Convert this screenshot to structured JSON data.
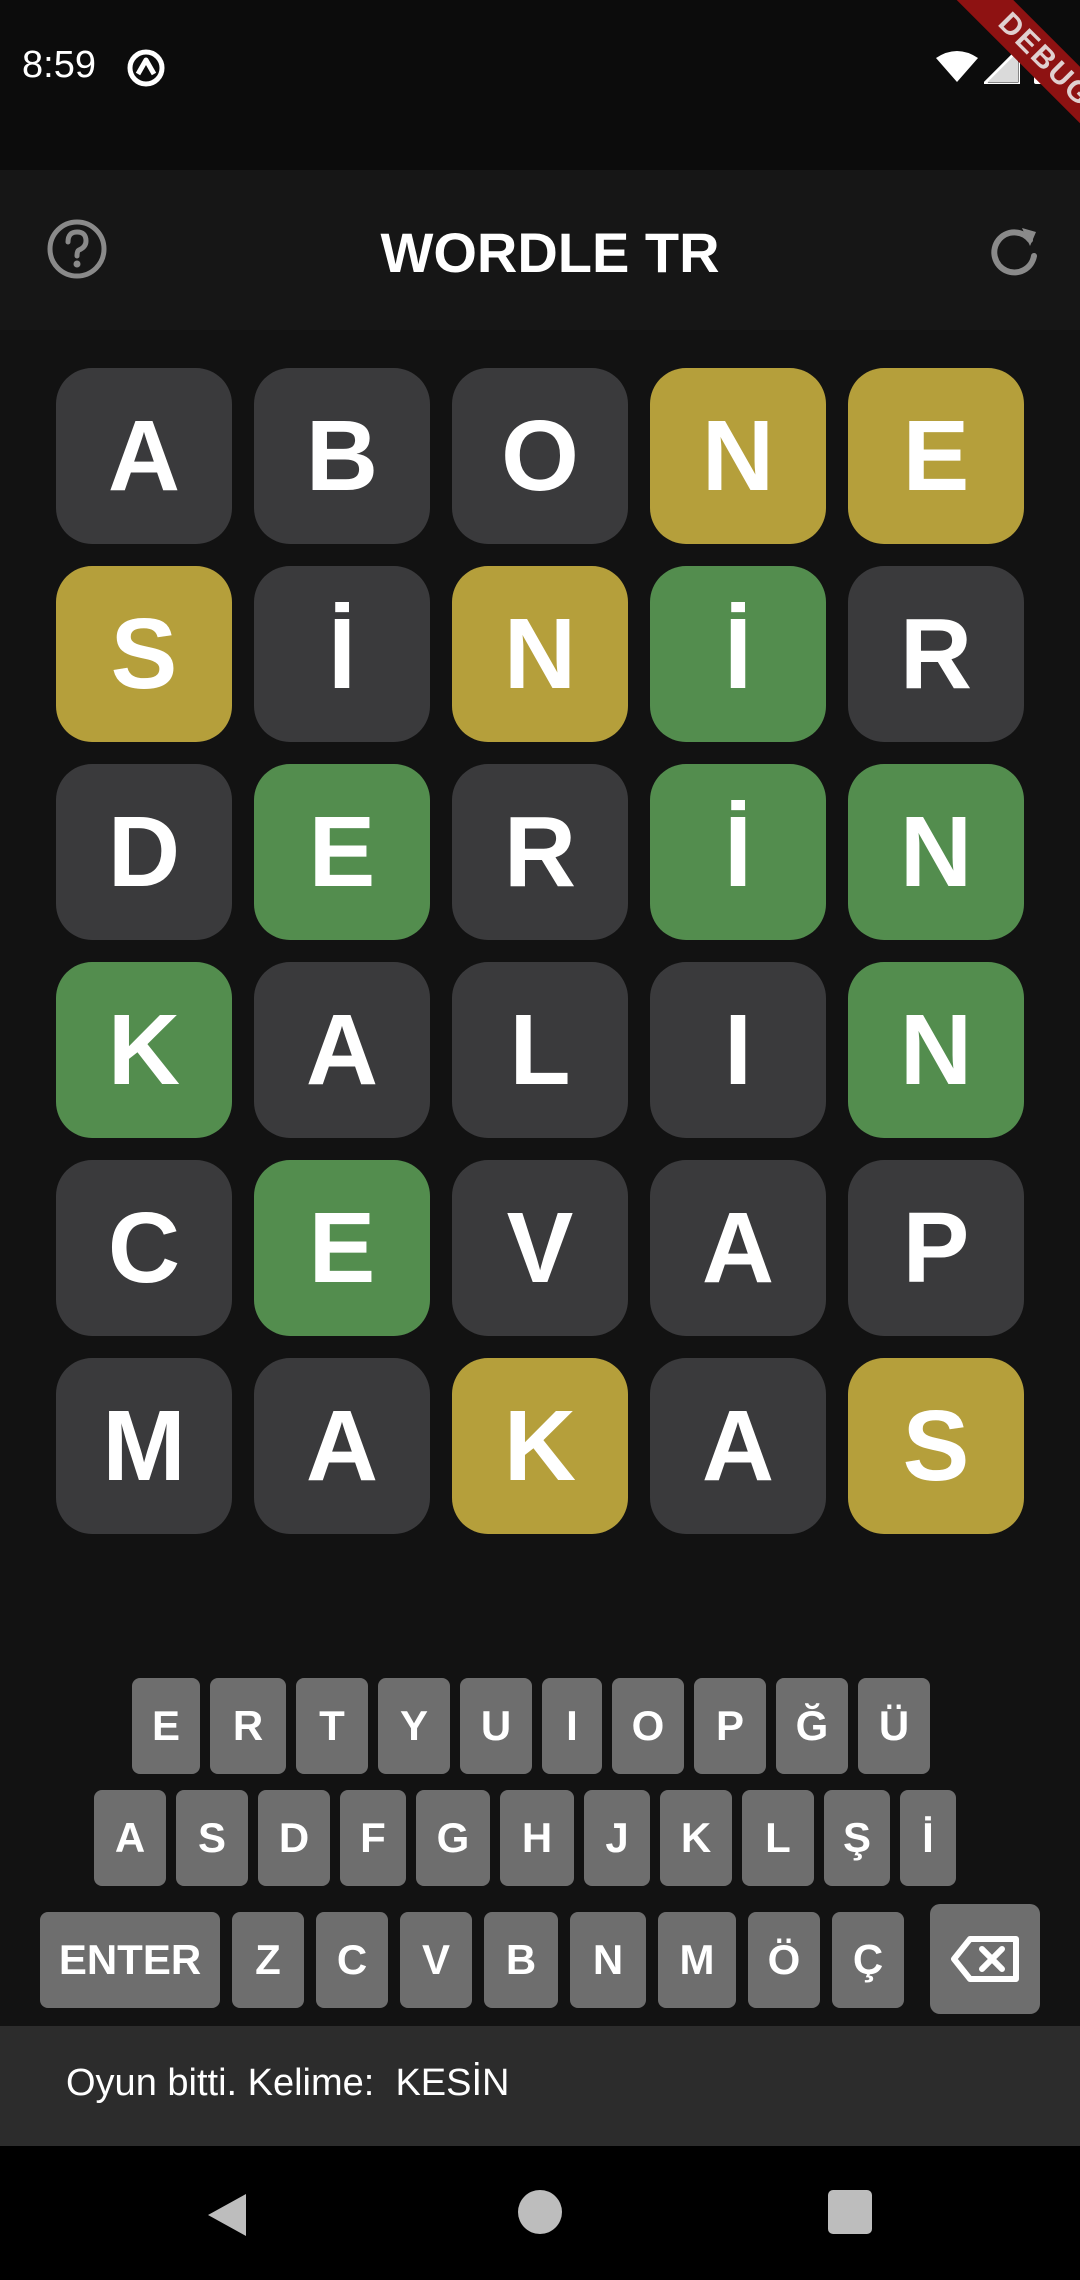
{
  "status_bar": {
    "time": "8:59",
    "debug_label": "DEBUG",
    "icons": [
      "app-notification-icon",
      "wifi-icon",
      "signal-icon",
      "battery-icon"
    ]
  },
  "app_bar": {
    "title": "WORDLE TR",
    "left_icon": "help-icon",
    "right_icon": "refresh-icon"
  },
  "board": {
    "rows": [
      [
        {
          "letter": "A",
          "state": "absent"
        },
        {
          "letter": "B",
          "state": "absent"
        },
        {
          "letter": "O",
          "state": "absent"
        },
        {
          "letter": "N",
          "state": "present"
        },
        {
          "letter": "E",
          "state": "present"
        }
      ],
      [
        {
          "letter": "S",
          "state": "present"
        },
        {
          "letter": "İ",
          "state": "absent"
        },
        {
          "letter": "N",
          "state": "present"
        },
        {
          "letter": "İ",
          "state": "correct"
        },
        {
          "letter": "R",
          "state": "absent"
        }
      ],
      [
        {
          "letter": "D",
          "state": "absent"
        },
        {
          "letter": "E",
          "state": "correct"
        },
        {
          "letter": "R",
          "state": "absent"
        },
        {
          "letter": "İ",
          "state": "correct"
        },
        {
          "letter": "N",
          "state": "correct"
        }
      ],
      [
        {
          "letter": "K",
          "state": "correct"
        },
        {
          "letter": "A",
          "state": "absent"
        },
        {
          "letter": "L",
          "state": "absent"
        },
        {
          "letter": "I",
          "state": "absent"
        },
        {
          "letter": "N",
          "state": "correct"
        }
      ],
      [
        {
          "letter": "C",
          "state": "absent"
        },
        {
          "letter": "E",
          "state": "correct"
        },
        {
          "letter": "V",
          "state": "absent"
        },
        {
          "letter": "A",
          "state": "absent"
        },
        {
          "letter": "P",
          "state": "absent"
        }
      ],
      [
        {
          "letter": "M",
          "state": "absent"
        },
        {
          "letter": "A",
          "state": "absent"
        },
        {
          "letter": "K",
          "state": "present"
        },
        {
          "letter": "A",
          "state": "absent"
        },
        {
          "letter": "S",
          "state": "present"
        }
      ]
    ]
  },
  "keyboard": {
    "row1": [
      "E",
      "R",
      "T",
      "Y",
      "U",
      "I",
      "O",
      "P",
      "Ğ",
      "Ü"
    ],
    "row2": [
      "A",
      "S",
      "D",
      "F",
      "G",
      "H",
      "J",
      "K",
      "L",
      "Ş",
      "İ"
    ],
    "row3": [
      "ENTER",
      "Z",
      "C",
      "V",
      "B",
      "N",
      "M",
      "Ö",
      "Ç"
    ],
    "backspace_icon": "backspace-icon"
  },
  "snackbar": {
    "message": "Oyun bitti. Kelime:  KESİN"
  },
  "colors": {
    "background": "#121212",
    "tile_absent": "#3a3a3c",
    "tile_present": "#b59f3b",
    "tile_correct": "#538d4e",
    "key": "#6e6e6e"
  },
  "nav_bar": {
    "icons": [
      "back-icon",
      "home-icon",
      "recents-icon"
    ]
  }
}
